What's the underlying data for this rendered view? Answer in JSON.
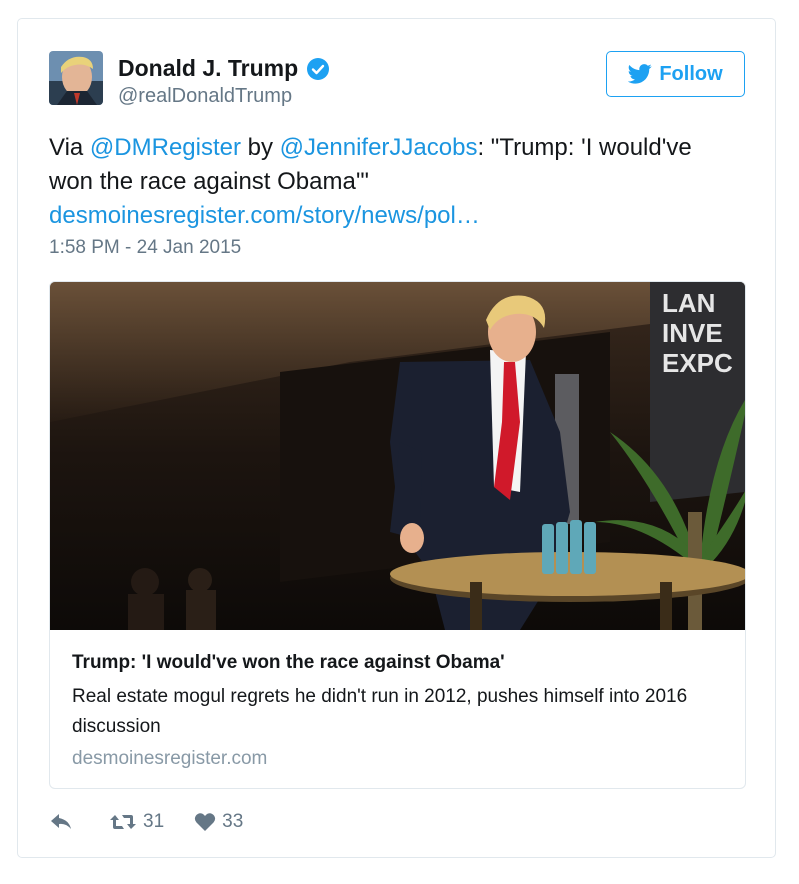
{
  "user": {
    "name": "Donald J. Trump",
    "handle": "@realDonaldTrump",
    "verified": true
  },
  "follow_label": "Follow",
  "tweet": {
    "prefix": "Via ",
    "mention1": "@DMRegister",
    "by": " by ",
    "mention2": "@JenniferJJacobs",
    "quote": ": \"Trump: 'I would've won the race against Obama'\"",
    "link": "desmoinesregister.com/story/news/pol…",
    "timestamp": "1:58 PM - 24 Jan 2015"
  },
  "card": {
    "headline": "Trump: 'I would've won the race against Obama'",
    "description": "Real estate mogul regrets he didn't run in 2012, pushes himself into 2016 discussion",
    "domain": "desmoinesregister.com",
    "photo_sign_text": [
      "LAN",
      "INVE",
      "EXPC"
    ]
  },
  "actions": {
    "reply_icon": "reply-icon",
    "retweet_count": "31",
    "like_count": "33"
  },
  "colors": {
    "accent": "#1da1f2",
    "link": "#1b95e0",
    "muted": "#657786",
    "tie": "#d0192a"
  }
}
